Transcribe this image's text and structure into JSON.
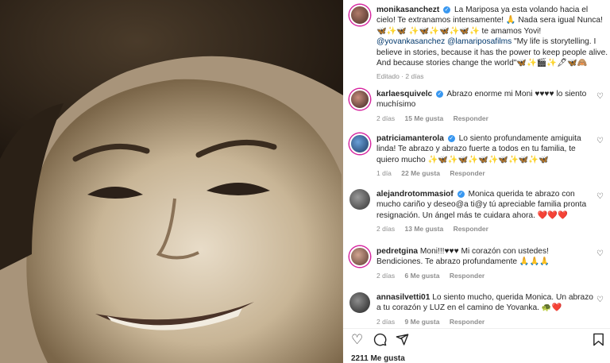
{
  "post": {
    "author": "monikasanchezt",
    "caption_text": "La Mariposa ya esta volando hacia el cielo! Te extranamos intensamente! 🙏 Nada sera igual Nunca! 🦋✨🦋 ✨🦋✨🦋✨🦋✨ te amamos Yovi!",
    "mention1": "@yovankasanchez",
    "mention2": "@lamariposafilms",
    "quote": "\"My life is storytelling. I believe in stories, because it has the power to keep people alive. And because stories change the world\"🦋✨🎬✨🖋🦋🙈",
    "edited": "Editado · 2 días"
  },
  "comments": [
    {
      "user": "karlaesquivelc",
      "text": "Abrazo enorme mi Moni ♥♥♥♥ lo siento muchísimo",
      "time": "2 días",
      "likes": "15 Me gusta",
      "reply": "Responder"
    },
    {
      "user": "patriciamanterola",
      "text": "Lo siento profundamente amiguita linda! Te abrazo y abrazo fuerte a todos en tu familia, te quiero mucho ✨🦋✨🦋✨🦋✨🦋✨🦋✨🦋",
      "time": "1 día",
      "likes": "22 Me gusta",
      "reply": "Responder"
    },
    {
      "user": "alejandrotommasiof",
      "text": "Monica querida te abrazo con mucho cariño y deseo@a ti@y tú apreciable familia pronta resignación. Un ángel más te cuidara ahora. ❤️❤️❤️",
      "time": "2 días",
      "likes": "13 Me gusta",
      "reply": "Responder"
    },
    {
      "user": "pedretgina",
      "text": "Moni!!!♥♥♥ Mi corazón con ustedes! Bendiciones. Te abrazo profundamente 🙏🙏🙏",
      "time": "2 días",
      "likes": "6 Me gusta",
      "reply": "Responder"
    },
    {
      "user": "annasilvetti01",
      "text": "Lo siento mucho, querida Monica. Un abrazo a tu corazón y LUZ en el camino de Yovanka. 🐢❤️",
      "time": "2 días",
      "likes": "9 Me gusta",
      "reply": "Responder"
    }
  ],
  "footer": {
    "likes": "2211 Me gusta"
  },
  "icons": {
    "like": "heart-outline-icon",
    "comment": "comment-icon",
    "share": "share-icon",
    "save": "bookmark-icon",
    "comment_like": "small-heart-icon",
    "verified": "verified-badge-icon"
  },
  "colors": {
    "mention": "#00376b",
    "verified": "#3897f0",
    "muted": "#8e8e8e"
  }
}
